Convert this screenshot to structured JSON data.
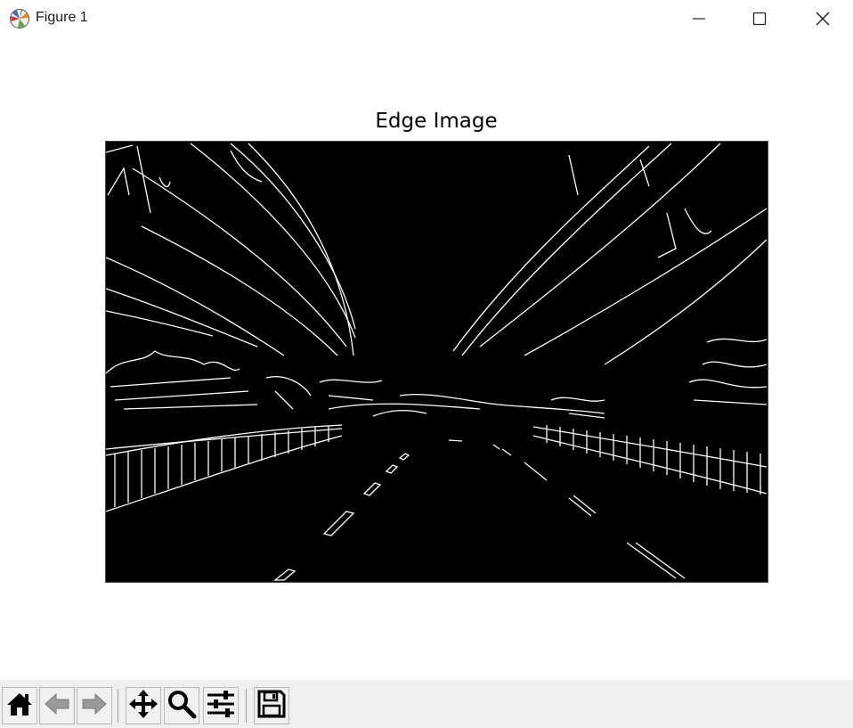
{
  "window": {
    "title": "Figure 1",
    "controls": {
      "minimize": "minimize",
      "maximize": "maximize",
      "close": "close"
    }
  },
  "axes": {
    "title": "Edge Image"
  },
  "toolbar": {
    "buttons": [
      {
        "icon": "home-icon",
        "enabled": true
      },
      {
        "icon": "back-arrow-icon",
        "enabled": false
      },
      {
        "icon": "forward-arrow-icon",
        "enabled": false
      },
      {
        "icon": "pan-move-icon",
        "enabled": true
      },
      {
        "icon": "zoom-magnifier-icon",
        "enabled": true
      },
      {
        "icon": "configure-subplots-icon",
        "enabled": true
      },
      {
        "icon": "save-floppy-icon",
        "enabled": true
      }
    ]
  },
  "colors": {
    "image_background": "#000000",
    "edge_color": "#ffffff",
    "toolbar_background": "#f0f0f0"
  }
}
